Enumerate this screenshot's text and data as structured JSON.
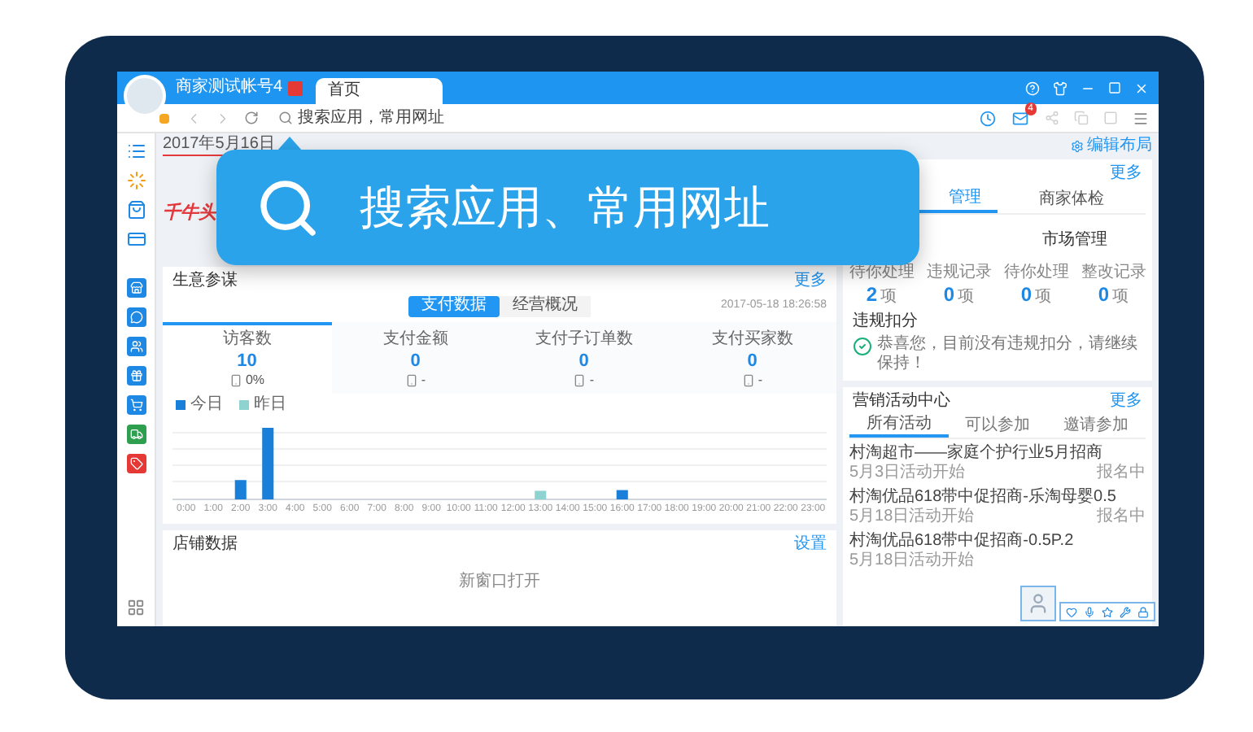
{
  "browser": {
    "account_name": "商家测试帐号4",
    "tabs": [
      {
        "label": "首页",
        "selected": true
      }
    ],
    "address_placeholder": "搜索应用，常用网址",
    "mail_badge": "4"
  },
  "callout": {
    "text": "搜索应用、常用网址"
  },
  "top": {
    "date": "2017年5月16日",
    "banner_text": "千牛头",
    "edit_layout": "编辑布局"
  },
  "business": {
    "title": "生意参谋",
    "more": "更多",
    "tabs": [
      {
        "label": "支付数据",
        "selected": true
      },
      {
        "label": "经营概况",
        "selected": false
      }
    ],
    "timestamp": "2017-05-18 18:26:58",
    "stats": [
      {
        "label": "访客数",
        "value": "10",
        "change": "0%",
        "selected": true
      },
      {
        "label": "支付金额",
        "value": "0",
        "change": "-",
        "selected": false
      },
      {
        "label": "支付子订单数",
        "value": "0",
        "change": "-",
        "selected": false
      },
      {
        "label": "支付买家数",
        "value": "0",
        "change": "-",
        "selected": false
      }
    ],
    "legend": [
      {
        "label": "今日",
        "color": "#1a7fd9"
      },
      {
        "label": "昨日",
        "color": "#8fd3d0"
      }
    ],
    "x_labels": [
      "0:00",
      "1:00",
      "2:00",
      "3:00",
      "4:00",
      "5:00",
      "6:00",
      "7:00",
      "8:00",
      "9:00",
      "10:00",
      "11:00",
      "12:00",
      "13:00",
      "14:00",
      "15:00",
      "16:00",
      "17:00",
      "18:00",
      "19:00",
      "20:00",
      "21:00",
      "22:00",
      "23:00"
    ]
  },
  "shop": {
    "title": "店铺数据",
    "settings": "设置",
    "link": "新窗口打开"
  },
  "right_top": {
    "more": "更多",
    "tabs": [
      {
        "label": "管理",
        "selected": true
      },
      {
        "label": "商家体检",
        "selected": false
      }
    ],
    "group_title": "市场管理",
    "counters": [
      {
        "label": "待你处理",
        "value": "2",
        "unit": "项"
      },
      {
        "label": "违规记录",
        "value": "0",
        "unit": "项"
      },
      {
        "label": "待你处理",
        "value": "0",
        "unit": "项"
      },
      {
        "label": "整改记录",
        "value": "0",
        "unit": "项"
      }
    ],
    "penalty_title": "违规扣分",
    "penalty_message": "恭喜您，目前没有违规扣分，请继续保持！"
  },
  "marketing": {
    "title": "营销活动中心",
    "more": "更多",
    "tabs": [
      {
        "label": "所有活动",
        "selected": true
      },
      {
        "label": "可以参加",
        "selected": false
      },
      {
        "label": "邀请参加",
        "selected": false
      }
    ],
    "items": [
      {
        "title": "村淘超市——家庭个护行业5月招商",
        "date": "5月3日活动开始",
        "status": "报名中"
      },
      {
        "title": "村淘优品618带中促招商-乐淘母婴0.5",
        "date": "5月18日活动开始",
        "status": "报名中"
      },
      {
        "title": "村淘优品618带中促招商-0.5P.2",
        "date": "5月18日活动开始"
      }
    ]
  }
}
